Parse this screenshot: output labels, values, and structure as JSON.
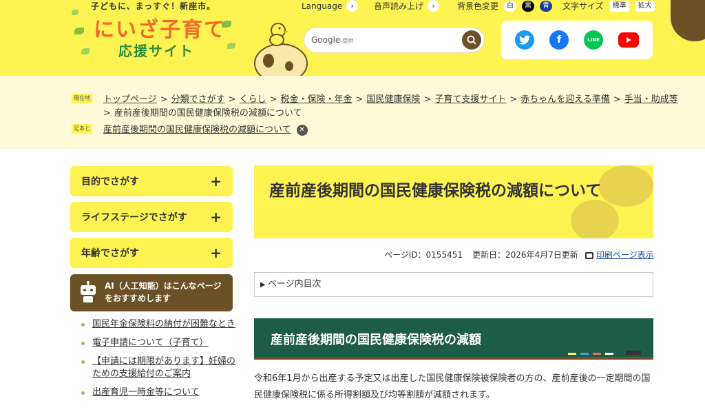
{
  "header": {
    "logo_tagline": "子どもに、まっすぐ！新座市。",
    "logo_main": "にいざ子育て",
    "logo_sub": "応援サイト",
    "language_label": "Language",
    "voice_label": "音声読み上げ",
    "bgcolor_label": "背景色変更",
    "bgcolor_white": "白",
    "bgcolor_black": "黒",
    "bgcolor_blue": "青",
    "fontsize_label": "文字サイズ",
    "fontsize_standard": "標準",
    "fontsize_large": "拡大",
    "search_brand": "Google",
    "search_brand_sub": "提供",
    "search_placeholder": ""
  },
  "breadcrumb": {
    "current_label": "現在地",
    "items": [
      "トップページ",
      "分類でさがす",
      "くらし",
      "税金・保険・年金",
      "国民健康保険",
      "子育て支援サイト",
      "赤ちゃんを迎える準備",
      "手当・助成等"
    ],
    "current": "産前産後期間の国民健康保険税の減額について",
    "footprint_label": "足あと",
    "footprint_item": "産前産後期間の国民健康保険税の減額について"
  },
  "sidebar": {
    "accordions": [
      "目的でさがす",
      "ライフステージでさがす",
      "年齢でさがす"
    ],
    "ai_text": "AI（人工知能）はこんなページをおすすめします",
    "links": [
      "国民年金保険料の納付が困難なとき",
      "電子申請について（子育て）",
      "【申請には期限があります】妊婦のための支援給付のご案内",
      "出産育児一時金等について"
    ]
  },
  "main": {
    "title": "産前産後期間の国民健康保険税の減額について",
    "page_id": "ページID：0155451",
    "updated": "更新日：2026年4月7日更新",
    "print_label": "印刷ページ表示",
    "toc_label": "ページ内目次",
    "section_heading": "産前産後期間の国民健康保険税の減額",
    "body": "令和6年1月から出産する予定又は出産した国民健康保険被保険者の方の、産前産後の一定期間の国民健康保険税に係る所得割額及び均等割額が減額されます。"
  },
  "colors": {
    "header_yellow": "#fff352",
    "crumb_bg": "#fffbd8",
    "brown": "#6b5226",
    "green_board": "#1d5c46",
    "link_blue": "#1a4fa0"
  }
}
